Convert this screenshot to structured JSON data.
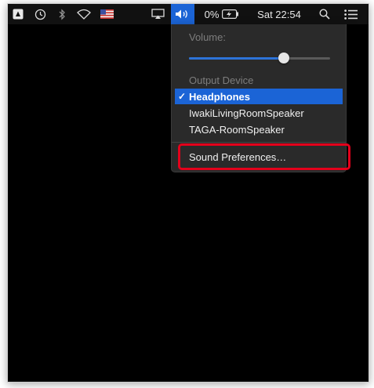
{
  "menubar": {
    "battery_percent": "0%",
    "clock": "Sat 22:54"
  },
  "volume_menu": {
    "volume_label": "Volume:",
    "volume_level": 0.67,
    "output_device_label": "Output Device",
    "devices": [
      {
        "label": "Headphones",
        "selected": true
      },
      {
        "label": "IwakiLivingRoomSpeaker",
        "selected": false
      },
      {
        "label": "TAGA-RoomSpeaker",
        "selected": false
      }
    ],
    "preferences_label": "Sound Preferences…"
  },
  "colors": {
    "accent": "#1b64d6",
    "annotation": "#e3001b"
  }
}
